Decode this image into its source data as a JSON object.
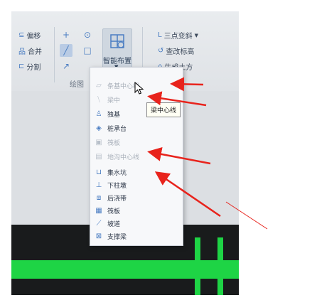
{
  "ribbon": {
    "left_col": [
      {
        "icon": "offset-icon",
        "glyph": "⊆",
        "label": "偏移"
      },
      {
        "icon": "merge-icon",
        "glyph": "品",
        "label": "合并"
      },
      {
        "icon": "split-icon",
        "glyph": "⊏",
        "label": "分割"
      }
    ],
    "tools": [
      {
        "icon": "crosshair-icon",
        "glyph": "+"
      },
      {
        "icon": "circle-icon",
        "glyph": "⊙"
      },
      {
        "icon": "line-icon",
        "glyph": "╱"
      },
      {
        "icon": "rectangle-icon",
        "glyph": "□"
      },
      {
        "icon": "arc-icon",
        "glyph": "↗"
      }
    ],
    "smart_layout_label": "智能布置",
    "right_col": [
      {
        "icon": "three-point-slope-icon",
        "glyph": "L",
        "label": "三点变斜"
      },
      {
        "icon": "check-elevation-icon",
        "glyph": "↺",
        "label": "查改标高"
      },
      {
        "icon": "generate-earthwork-icon",
        "glyph": "⌂",
        "label": "生成土方"
      }
    ],
    "group_label": "绘图"
  },
  "menu": {
    "items": [
      {
        "icon": "strip-foundation-icon",
        "glyph": "▱",
        "label": "条基中心线",
        "enabled": false
      },
      {
        "icon": "beam-centerline-icon",
        "glyph": "⧹",
        "label": "梁中",
        "enabled": false
      },
      {
        "icon": "isolated-footing-icon",
        "glyph": "♙",
        "label": "独基",
        "enabled": true
      },
      {
        "icon": "pile-cap-icon",
        "glyph": "◈",
        "label": "桩承台",
        "enabled": true
      },
      {
        "icon": "raft-slab-icon",
        "glyph": "▣",
        "label": "筏板",
        "enabled": false
      },
      {
        "icon": "ground-beam-centerline-icon",
        "glyph": "▤",
        "label": "地沟中心线",
        "enabled": false
      },
      {
        "icon": "sump-pit-icon",
        "glyph": "⊔",
        "label": "集水坑",
        "enabled": true
      },
      {
        "icon": "column-pier-icon",
        "glyph": "⊥",
        "label": "下柱墩",
        "enabled": true
      },
      {
        "icon": "post-pour-strip-icon",
        "glyph": "⧈",
        "label": "后浇带",
        "enabled": true
      },
      {
        "icon": "slab-icon",
        "glyph": "▦",
        "label": "筏板",
        "enabled": true
      },
      {
        "icon": "ramp-icon",
        "glyph": "⟋",
        "label": "坡道",
        "enabled": true
      },
      {
        "icon": "support-beam-icon",
        "glyph": "⊠",
        "label": "支撑梁",
        "enabled": true
      }
    ],
    "tooltip": "梁中心线"
  },
  "colors": {
    "arrow": "#e8231c",
    "accent": "#4a7dc2",
    "green": "#1ed445"
  }
}
